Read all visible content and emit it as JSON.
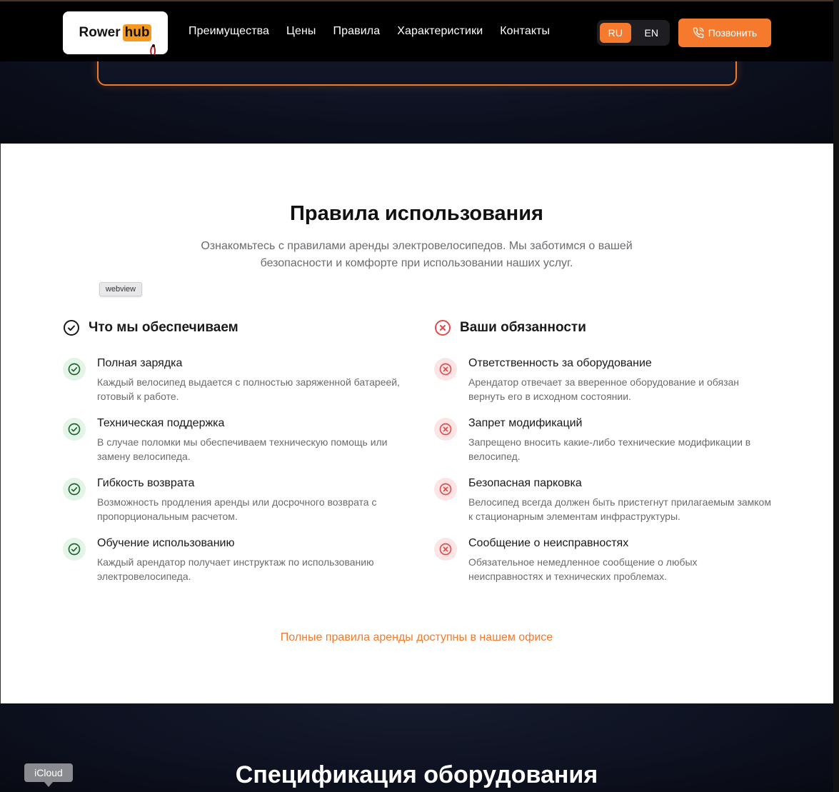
{
  "header": {
    "logo": {
      "word": "Rower",
      "hub": "hub"
    },
    "nav": [
      "Преимущества",
      "Цены",
      "Правила",
      "Характеристики",
      "Контакты"
    ],
    "lang": {
      "active": "RU",
      "inactive": "EN"
    },
    "call_label": "Позвонить",
    "accent": "#f57a2e"
  },
  "rules": {
    "title": "Правила использования",
    "subtitle": "Ознакомьтесь с правилами аренды электровелосипедов. Мы заботимся о вашей безопасности и комфорте при использовании наших услуг.",
    "webview_tag": "webview",
    "provide": {
      "heading": "Что мы обеспечиваем",
      "items": [
        {
          "title": "Полная зарядка",
          "desc": "Каждый велосипед выдается с полностью заряженной батареей, готовый к работе."
        },
        {
          "title": "Техническая поддержка",
          "desc": "В случае поломки мы обеспечиваем техническую помощь или замену велосипеда."
        },
        {
          "title": "Гибкость возврата",
          "desc": "Возможность продления аренды или досрочного возврата с пропорциональным расчетом."
        },
        {
          "title": "Обучение использованию",
          "desc": "Каждый арендатор получает инструктаж по использованию электровелосипеда."
        }
      ]
    },
    "duties": {
      "heading": "Ваши обязанности",
      "items": [
        {
          "title": "Ответственность за оборудование",
          "desc": "Арендатор отвечает за вверенное оборудование и обязан вернуть его в исходном состоянии."
        },
        {
          "title": "Запрет модификаций",
          "desc": "Запрещено вносить какие-либо технические модификации в велосипед."
        },
        {
          "title": "Безопасная парковка",
          "desc": "Велосипед всегда должен быть пристегнут прилагаемым замком к стационарным элементам инфраструктуры."
        },
        {
          "title": "Сообщение о неисправностях",
          "desc": "Обязательное немедленное сообщение о любых неисправностях и технических проблемах."
        }
      ]
    },
    "footer_note": "Полные правила аренды доступны в нашем офисе"
  },
  "specs": {
    "title": "Спецификация оборудования"
  },
  "tooltip": {
    "icloud": "iCloud"
  }
}
